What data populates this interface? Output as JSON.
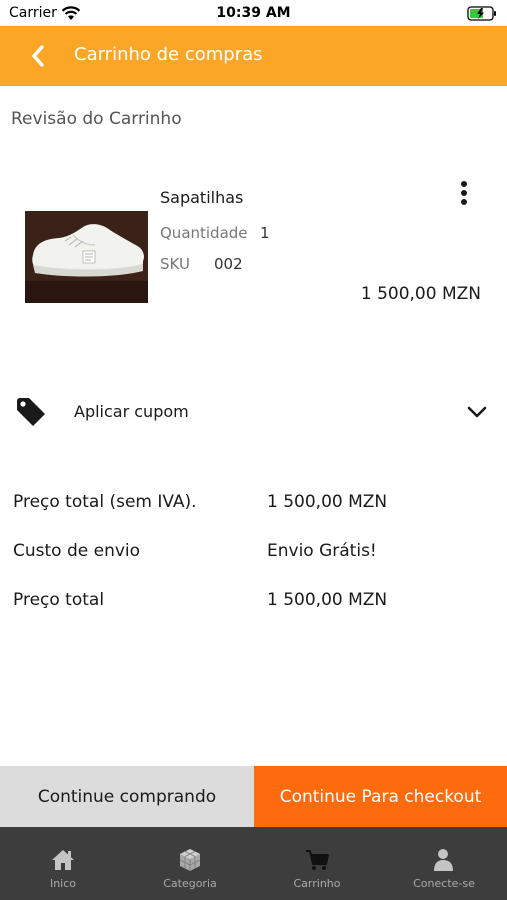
{
  "status_bar": {
    "carrier": "Carrier",
    "time": "10:39 AM"
  },
  "header": {
    "title": "Carrinho de compras",
    "background_color": "#fca627",
    "back_icon": "chevron-left-icon"
  },
  "main": {
    "section_title": "Revisão do Carrinho",
    "cart_items": [
      {
        "name": "Sapatilhas",
        "quantity_label": "Quantidade",
        "quantity": "1",
        "sku_label": "SKU",
        "sku": "002",
        "price": "1 500,00 MZN",
        "menu_icon": "more-vertical-icon"
      }
    ],
    "coupon": {
      "label": "Aplicar cupom",
      "icon": "tag-icon",
      "expand_icon": "chevron-down-icon"
    },
    "summary": [
      {
        "label": "Preço total (sem IVA).",
        "value": "1 500,00 MZN"
      },
      {
        "label": "Custo de envio",
        "value": "Envio Grátis!"
      },
      {
        "label": "Preço total",
        "value": "1 500,00 MZN"
      }
    ]
  },
  "actions": {
    "continue_shopping": "Continue comprando",
    "checkout": "Continue Para checkout",
    "checkout_color": "#fd6b0e"
  },
  "tab_bar": {
    "items": [
      {
        "label": "Inico",
        "icon": "home-icon"
      },
      {
        "label": "Categoria",
        "icon": "category-cube-icon"
      },
      {
        "label": "Carrinho",
        "icon": "cart-icon"
      },
      {
        "label": "Conecte-se",
        "icon": "user-icon"
      }
    ]
  }
}
